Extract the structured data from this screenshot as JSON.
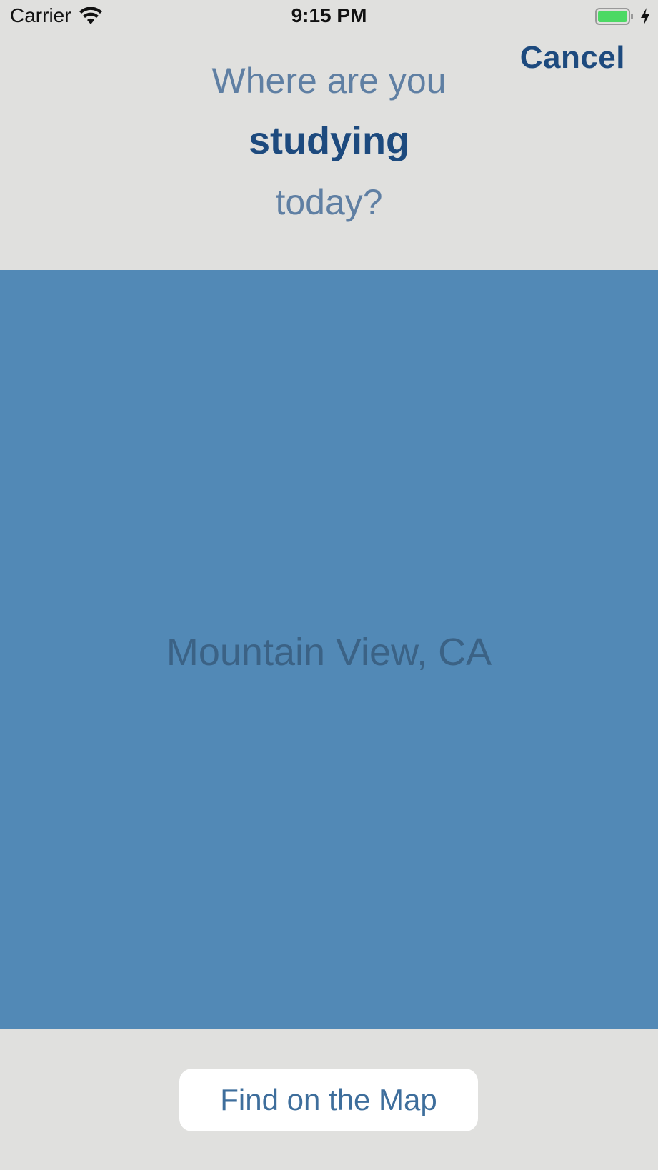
{
  "status_bar": {
    "carrier": "Carrier",
    "time": "9:15 PM",
    "wifi_icon": "wifi-icon",
    "battery_icon": "battery-charging-icon"
  },
  "header": {
    "cancel_label": "Cancel",
    "prompt_line1": "Where are you",
    "prompt_line2": "studying",
    "prompt_line3": "today?"
  },
  "location": {
    "placeholder": "Mountain View, CA",
    "value": ""
  },
  "footer": {
    "find_button_label": "Find on the Map"
  },
  "colors": {
    "background": "#e0e0de",
    "panel": "#5289b6",
    "accent_dark": "#1d4a7e",
    "accent_light": "#5f7fa3",
    "battery_green": "#4cd964"
  }
}
